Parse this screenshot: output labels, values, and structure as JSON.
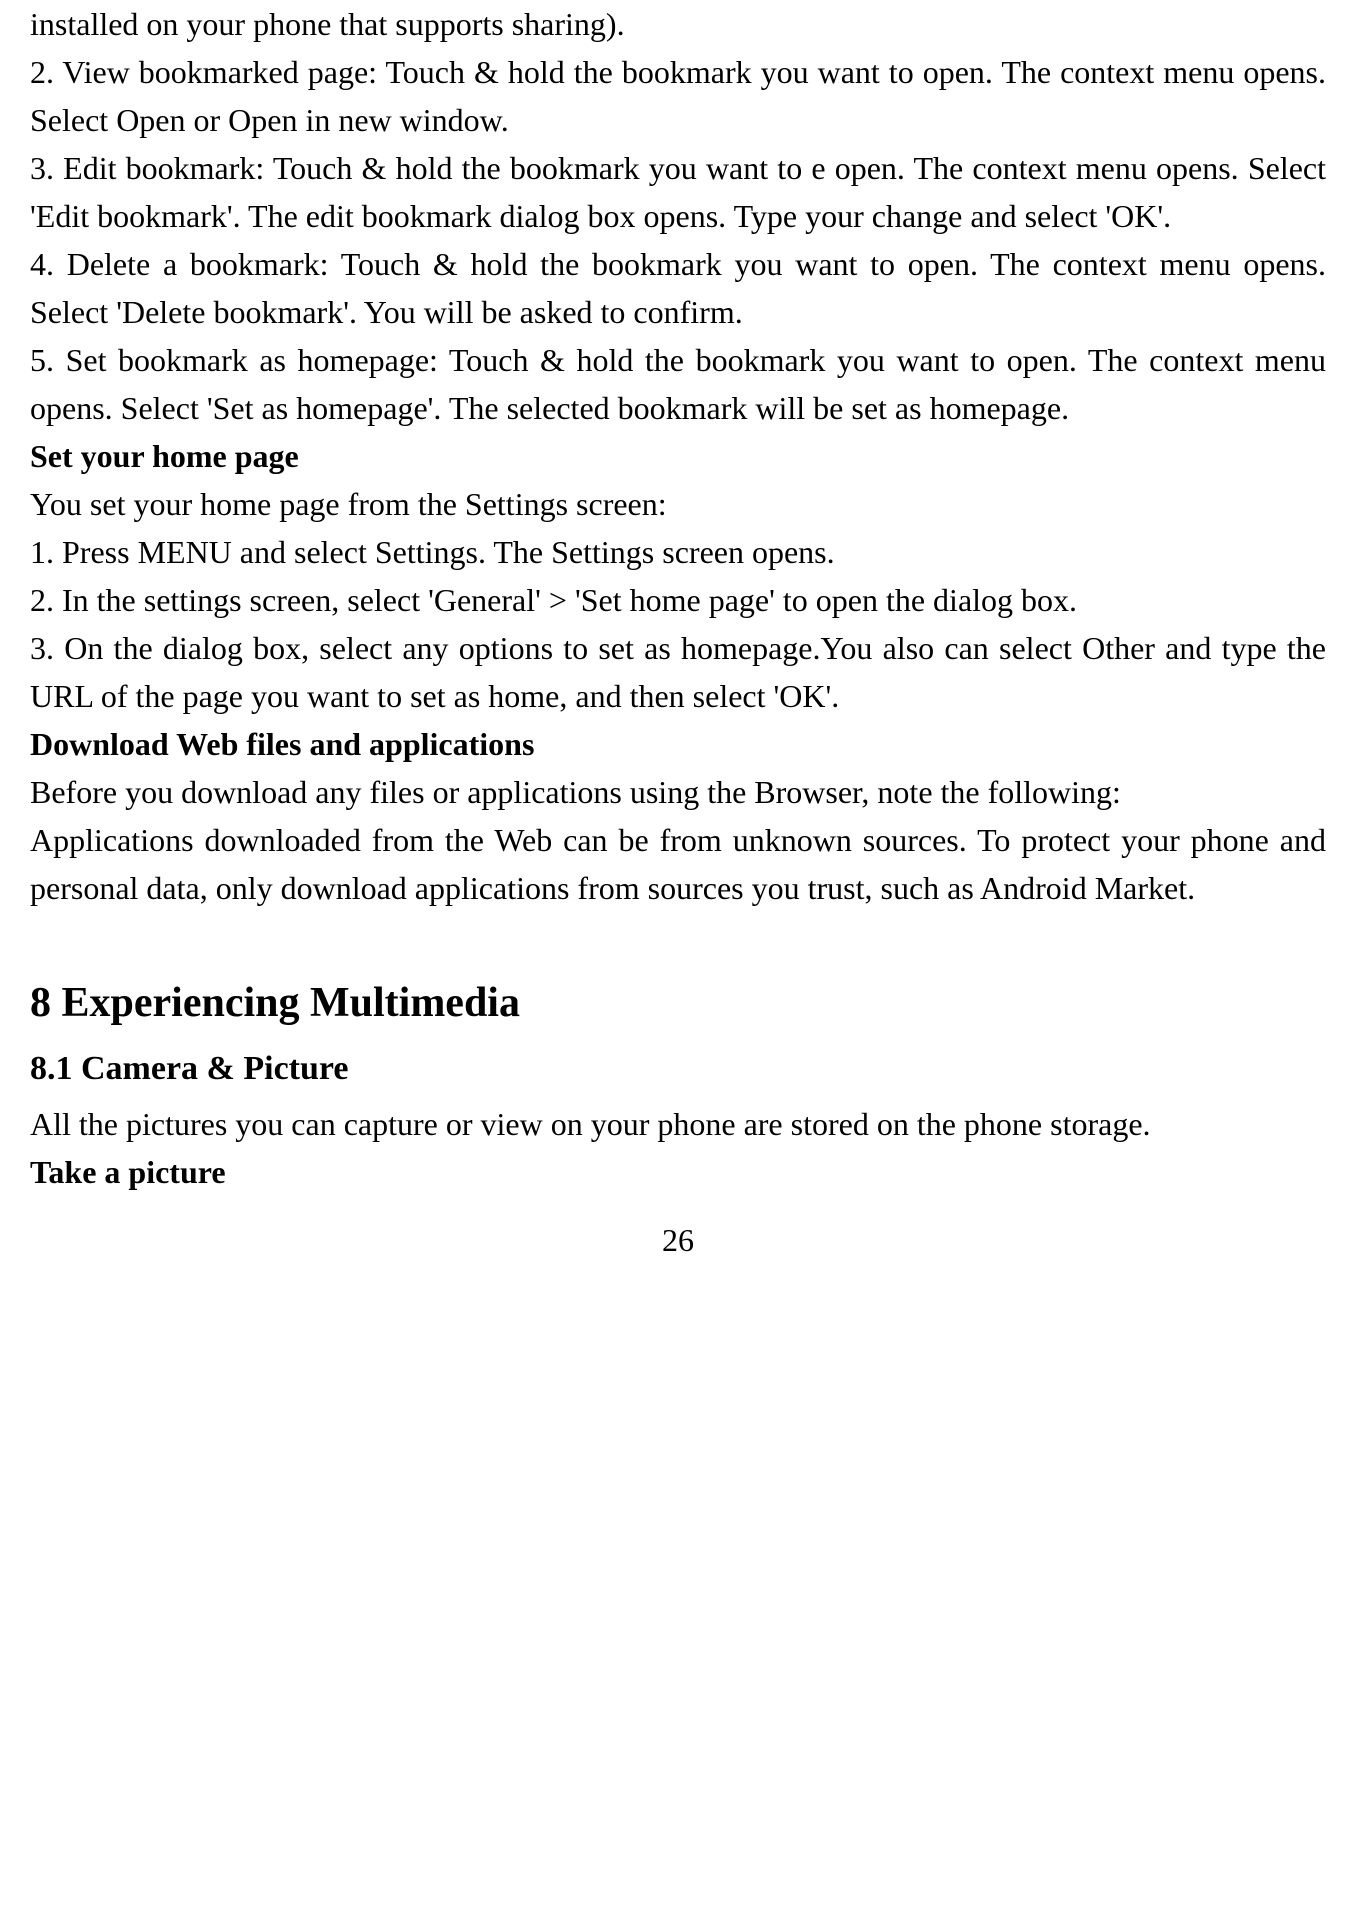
{
  "paragraphs": {
    "p1": "installed on your phone that supports sharing).",
    "p2": "2. View bookmarked page: Touch & hold the bookmark you want to open. The context menu opens. Select Open or Open in new window.",
    "p3": "3. Edit bookmark: Touch & hold the bookmark you want to e open. The context menu opens. Select 'Edit bookmark'. The edit bookmark dialog box opens. Type your change and select 'OK'.",
    "p4": "4. Delete a bookmark: Touch & hold the bookmark you want to open. The context menu opens. Select 'Delete bookmark'. You will be asked to confirm.",
    "p5": "5. Set bookmark as homepage: Touch & hold the bookmark you want to open. The context menu opens. Select 'Set as homepage'. The selected bookmark will be set as homepage.",
    "h_set_home": "Set your home page",
    "p6": "You set your home page from the Settings screen:",
    "p7": "1. Press MENU and select Settings. The Settings screen opens.",
    "p8": "2. In the settings screen, select 'General' > 'Set home page' to open the dialog box.",
    "p9": "3. On the dialog box, select any options to set as homepage.You also can select Other and type the URL of the page you want to set as home, and then select 'OK'.",
    "h_download": "Download Web files and applications",
    "p10": "Before you download any files or applications using the Browser, note the following:",
    "p11": "Applications downloaded from the Web can be from unknown sources. To protect your phone and personal data, only download applications from sources you trust, such as Android Market.",
    "h1_ch8": "8 Experiencing Multimedia",
    "h2_81": "8.1 Camera & Picture",
    "p12": "All the pictures you can capture or view on your phone are stored on the phone storage.",
    "h_take": "Take a picture",
    "page_num": "26"
  }
}
